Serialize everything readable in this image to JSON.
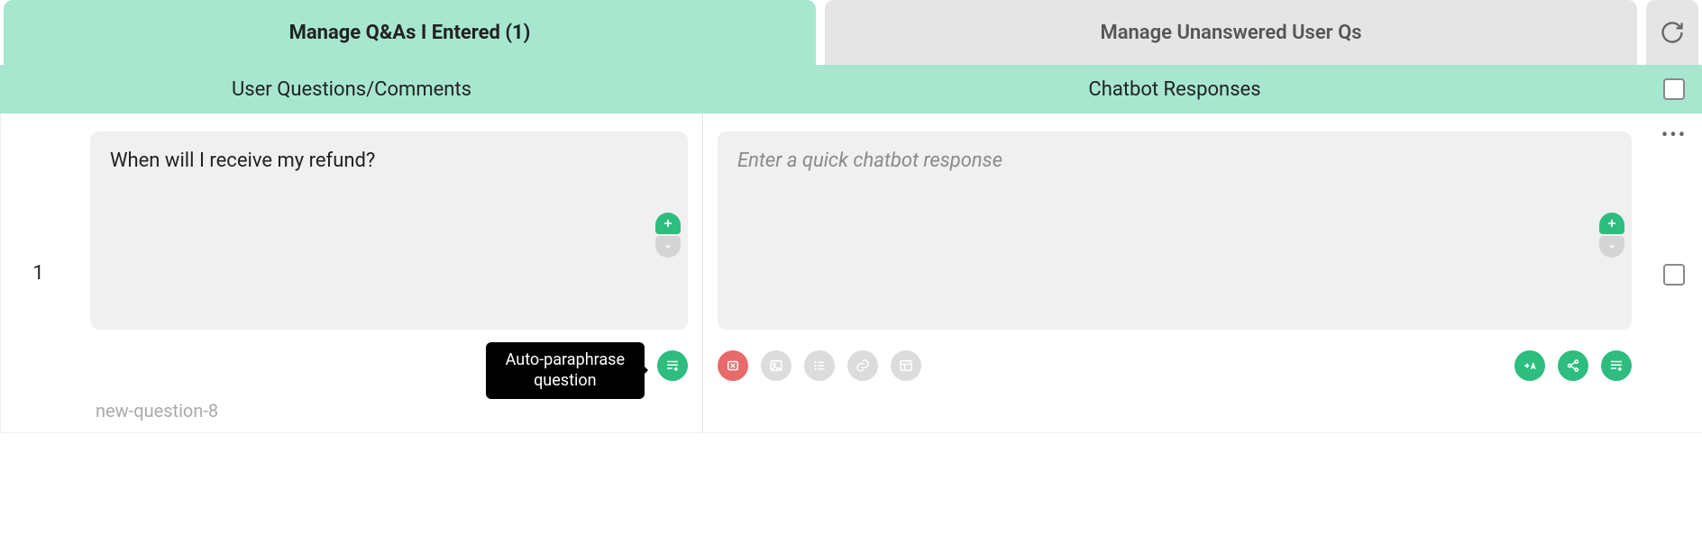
{
  "tabs": {
    "active": "Manage Q&As I Entered (1)",
    "inactive": "Manage Unanswered User Qs"
  },
  "headers": {
    "left": "User Questions/Comments",
    "right": "Chatbot Responses"
  },
  "row": {
    "index": "1",
    "question_value": "When will I receive my refund?",
    "response_placeholder": "Enter a quick chatbot response",
    "slug": "new-question-8",
    "tooltip": "Auto-paraphrase\nquestion"
  }
}
